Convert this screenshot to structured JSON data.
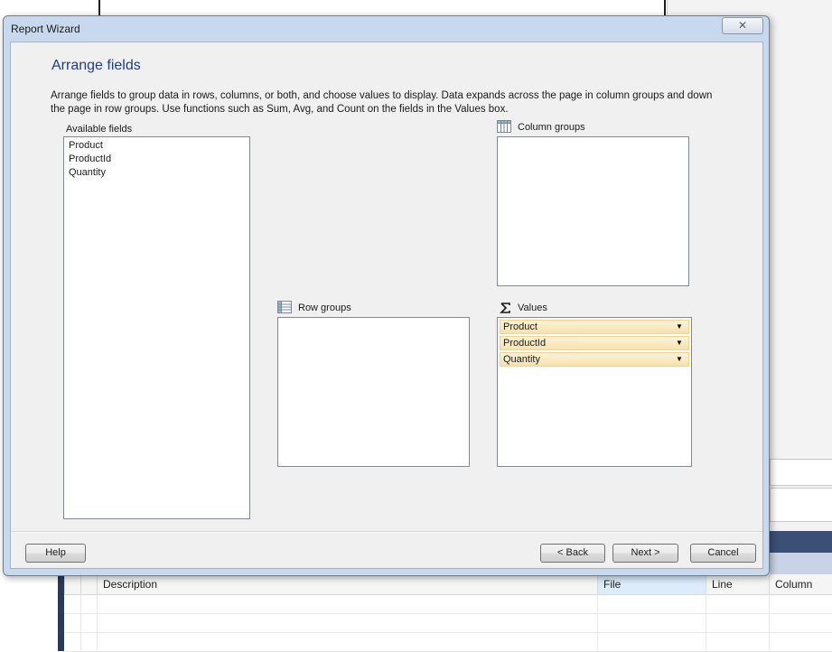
{
  "dialog": {
    "title": "Report Wizard",
    "close_symbol": "✕",
    "page_title": "Arrange fields",
    "instructions": "Arrange fields to group data in rows, columns, or both, and choose values to display. Data expands across the page in column groups and down the page in row groups.  Use functions such as Sum, Avg, and Count on the fields in the Values box."
  },
  "available_fields": {
    "label": "Available fields",
    "items": [
      "Product",
      "ProductId",
      "Quantity"
    ]
  },
  "column_groups": {
    "label": "Column groups",
    "icon": "column-groups-icon",
    "items": []
  },
  "row_groups": {
    "label": "Row groups",
    "icon": "row-groups-icon",
    "items": []
  },
  "values": {
    "label": "Values",
    "icon": "sigma-icon",
    "items": [
      "Product",
      "ProductId",
      "Quantity"
    ]
  },
  "buttons": {
    "help": "Help",
    "back": "< Back",
    "next": "Next >",
    "cancel": "Cancel"
  },
  "error_list": {
    "columns": [
      "Description",
      "File",
      "Line",
      "Column"
    ]
  },
  "colors": {
    "title_blue": "#1f3e8a",
    "value_item_bg": "#f8e2a8"
  }
}
